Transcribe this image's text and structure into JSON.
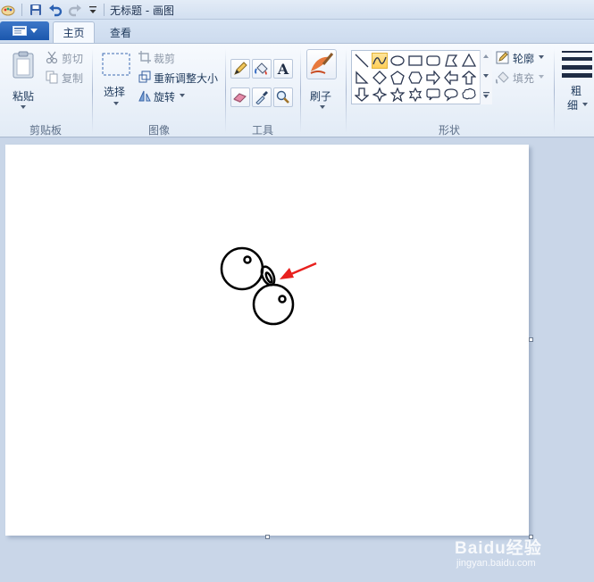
{
  "window": {
    "title": "无标题 - 画图"
  },
  "tabs": [
    {
      "label": "主页",
      "active": true
    },
    {
      "label": "查看",
      "active": false
    }
  ],
  "clipboard": {
    "paste": "粘贴",
    "cut": "剪切",
    "copy": "复制",
    "group": "剪贴板"
  },
  "image": {
    "select": "选择",
    "crop": "裁剪",
    "resize": "重新调整大小",
    "rotate": "旋转",
    "group": "图像"
  },
  "tools": {
    "group": "工具",
    "text_glyph": "A"
  },
  "brushes": {
    "label": "刷子"
  },
  "shapes": {
    "outline": "轮廓",
    "fill": "填充",
    "group": "形状"
  },
  "size": {
    "label_line1": "粗",
    "label_line2": "细"
  },
  "watermark": {
    "brand": "Baidu经验",
    "url": "jingyan.baidu.com"
  },
  "colors": {
    "ribbon_accent": "#1b57ad",
    "selected_shape": "#ffcf5a",
    "arrow": "#e8201e"
  }
}
